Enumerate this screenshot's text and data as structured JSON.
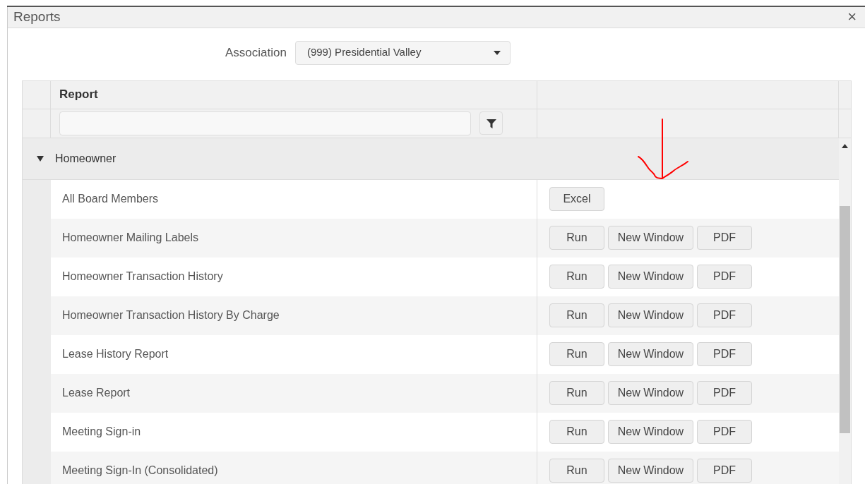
{
  "window": {
    "title": "Reports",
    "close": "×"
  },
  "association": {
    "label": "Association",
    "value": "(999) Presidential Valley"
  },
  "table": {
    "columns": [
      "Report"
    ],
    "group": {
      "label": "Homeowner",
      "expanded": true
    },
    "rows": [
      {
        "name": "All Board Members",
        "buttons": [
          "Excel"
        ]
      },
      {
        "name": "Homeowner Mailing Labels",
        "buttons": [
          "Run",
          "New Window",
          "PDF"
        ]
      },
      {
        "name": "Homeowner Transaction History",
        "buttons": [
          "Run",
          "New Window",
          "PDF"
        ]
      },
      {
        "name": "Homeowner Transaction History By Charge",
        "buttons": [
          "Run",
          "New Window",
          "PDF"
        ]
      },
      {
        "name": "Lease History Report",
        "buttons": [
          "Run",
          "New Window",
          "PDF"
        ]
      },
      {
        "name": "Lease Report",
        "buttons": [
          "Run",
          "New Window",
          "PDF"
        ]
      },
      {
        "name": "Meeting Sign-in",
        "buttons": [
          "Run",
          "New Window",
          "PDF"
        ]
      },
      {
        "name": "Meeting Sign-In (Consolidated)",
        "buttons": [
          "Run",
          "New Window",
          "PDF"
        ]
      }
    ]
  }
}
